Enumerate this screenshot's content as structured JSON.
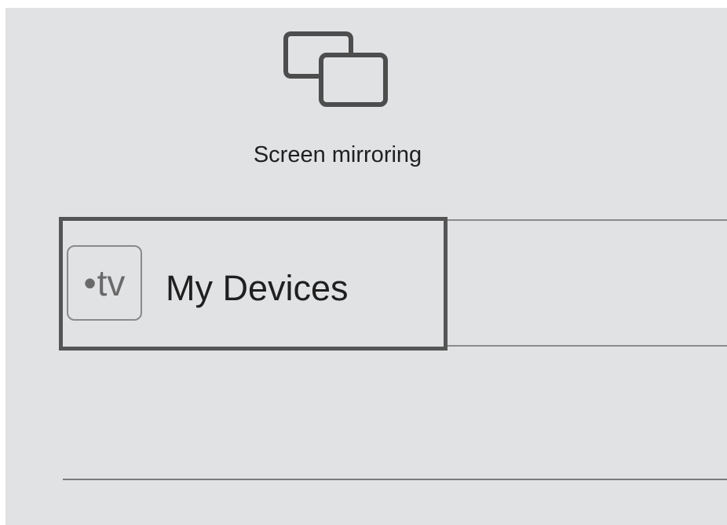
{
  "control_center": {
    "screen_mirroring": {
      "label": "Screen mirroring",
      "icon": "screen-mirroring-icon"
    },
    "my_devices": {
      "label": "My Devices",
      "badge_dot": "•",
      "badge_text": "tv",
      "icon": "apple-tv-icon"
    }
  },
  "colors": {
    "panel_background": "#e1e2e4",
    "focus_border": "#555555",
    "divider": "#7a7a7a",
    "text": "#1f1f1f"
  }
}
